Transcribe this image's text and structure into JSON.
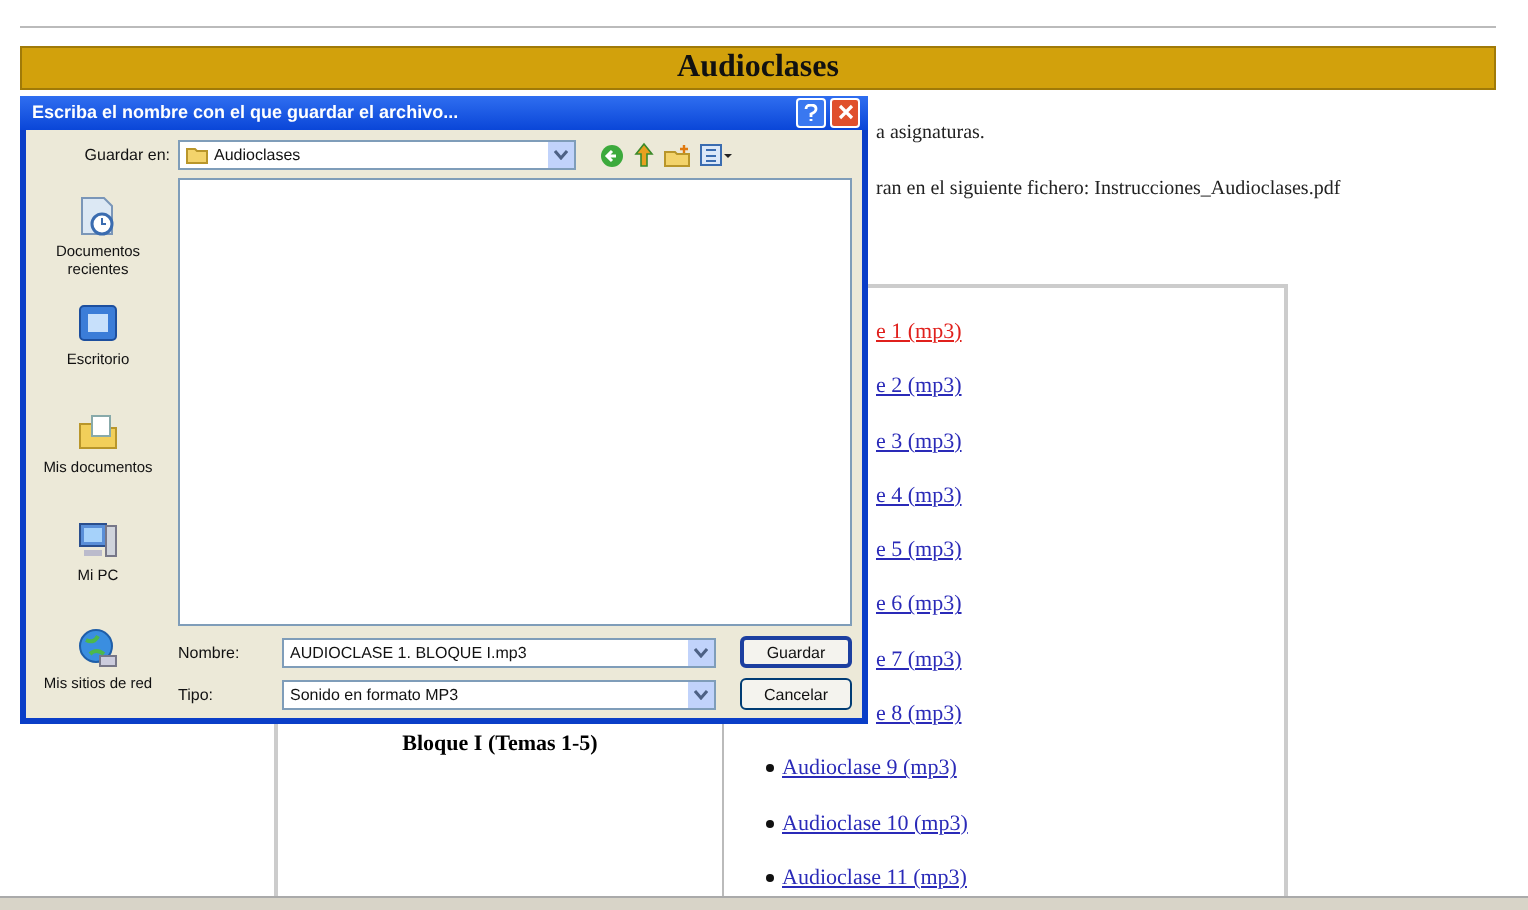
{
  "page": {
    "title": "Audioclases",
    "lines": [
      "a asignaturas.",
      "ran en el siguiente fichero: Instrucciones_Audioclases.pdf"
    ],
    "block_label": "Bloque I (Temas 1-5)",
    "links": [
      {
        "text": "e 1 (mp3)",
        "visited": true,
        "covered": true
      },
      {
        "text": "e 2 (mp3)",
        "visited": false,
        "covered": true
      },
      {
        "text": "e 3 (mp3)",
        "visited": false,
        "covered": true
      },
      {
        "text": "e 4 (mp3)",
        "visited": false,
        "covered": true
      },
      {
        "text": "e 5 (mp3)",
        "visited": false,
        "covered": true
      },
      {
        "text": "e 6 (mp3)",
        "visited": false,
        "covered": true
      },
      {
        "text": "e 7 (mp3)",
        "visited": false,
        "covered": true
      },
      {
        "text": "e 8 (mp3)",
        "visited": false,
        "covered": true
      },
      {
        "text": "Audioclase 9 (mp3)",
        "visited": false,
        "covered": false
      },
      {
        "text": "Audioclase 10 (mp3)",
        "visited": false,
        "covered": false
      },
      {
        "text": "Audioclase 11 (mp3)",
        "visited": false,
        "covered": false
      }
    ]
  },
  "dialog": {
    "title": "Escriba el nombre con el que guardar el archivo...",
    "save_in_label": "Guardar en:",
    "save_in_value": "Audioclases",
    "places": [
      {
        "label": "Documentos recientes",
        "kind": "recent"
      },
      {
        "label": "Escritorio",
        "kind": "desktop"
      },
      {
        "label": "Mis documentos",
        "kind": "documents"
      },
      {
        "label": "Mi PC",
        "kind": "computer"
      },
      {
        "label": "Mis sitios de red",
        "kind": "network"
      }
    ],
    "filename_label": "Nombre:",
    "filename": "AUDIOCLASE 1. BLOQUE I.mp3",
    "type_label": "Tipo:",
    "type": "Sonido en formato MP3",
    "buttons": [
      {
        "label": "Guardar",
        "default": true
      },
      {
        "label": "Cancelar",
        "default": false
      }
    ]
  }
}
